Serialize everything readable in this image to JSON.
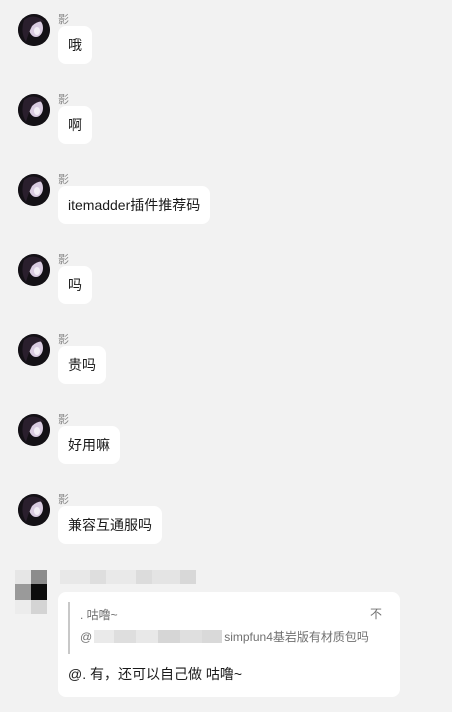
{
  "messages": [
    {
      "sender": "影",
      "text": "哦"
    },
    {
      "sender": "影",
      "text": "啊"
    },
    {
      "sender": "影",
      "text": "itemadder插件推荐码"
    },
    {
      "sender": "影",
      "text": "吗"
    },
    {
      "sender": "影",
      "text": "贵吗"
    },
    {
      "sender": "影",
      "text": "好用嘛"
    },
    {
      "sender": "影",
      "text": "兼容互通服吗"
    }
  ],
  "reply": {
    "quote_author": ". 咕噜~",
    "quote_side_text": "不",
    "quote_mention": "@",
    "quote_text": "simpfun4基岩版有材质包吗",
    "text": "@. 有，还可以自己做 咕噜~"
  }
}
